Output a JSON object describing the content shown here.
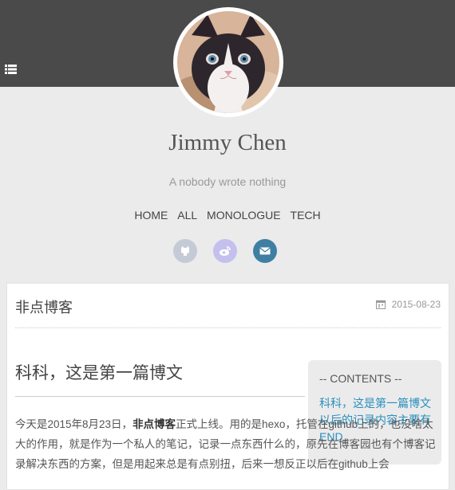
{
  "site": {
    "title": "Jimmy Chen",
    "subtitle": "A nobody wrote nothing"
  },
  "nav": {
    "items": [
      "HOME",
      "ALL",
      "MONOLOGUE",
      "TECH"
    ]
  },
  "social": [
    {
      "name": "github-icon",
      "color": "#c5cbd6"
    },
    {
      "name": "weibo-icon",
      "color": "#c4c0ee"
    },
    {
      "name": "mail-icon",
      "color": "#3f7fa3"
    }
  ],
  "post": {
    "title": "非点博客",
    "date": "2015-08-23",
    "heading": "科科，这是第一篇博文",
    "paragraph": {
      "part1": "今天是2015年8月23日，",
      "bold": "非点博客",
      "part2": "正式上线。用的是hexo，托管在github上的，也没啥太大的作用，就是作为一个私人的笔记，记录一点东西什么的，原先在博客园也有个博客记录解决东西的方案，但是用起来总是有点别扭，后来一想反正以后在github上会"
    }
  },
  "toc": {
    "title": "-- CONTENTS --",
    "item": "科科，这是第一篇博文以后的记录内容主要有END"
  },
  "colors": {
    "header_bg": "#4a4a4a",
    "page_bg": "#ebebeb",
    "link": "#2a8fbf"
  }
}
